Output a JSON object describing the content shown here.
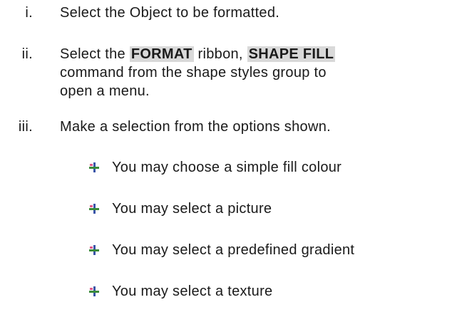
{
  "steps": [
    {
      "num": "i.",
      "text": "Select the Object to be formatted."
    },
    {
      "num": "ii.",
      "pre": "Select the ",
      "hl1": "FORMAT",
      "mid": " ribbon, ",
      "hl2": "SHAPE FILL",
      "line2": "command from the shape styles group to",
      "line3": "open a menu."
    },
    {
      "num": "iii.",
      "text": "Make a selection from the options shown."
    }
  ],
  "bullets": [
    {
      "icon": "plus-bullet-icon",
      "text": "You may choose a simple fill colour"
    },
    {
      "icon": "plus-bullet-icon",
      "text": "You may select a picture"
    },
    {
      "icon": "plus-bullet-icon",
      "text": "You may select a predefined gradient"
    },
    {
      "icon": "plus-bullet-icon",
      "text": "You may select a texture"
    }
  ],
  "colors": {
    "text": "#1a1a1a",
    "highlight": "#d9d9d9",
    "bullet_vertical": "#3a55a8",
    "bullet_horizontal": "#3a8a3a",
    "bullet_accent": "#e05a8a"
  }
}
